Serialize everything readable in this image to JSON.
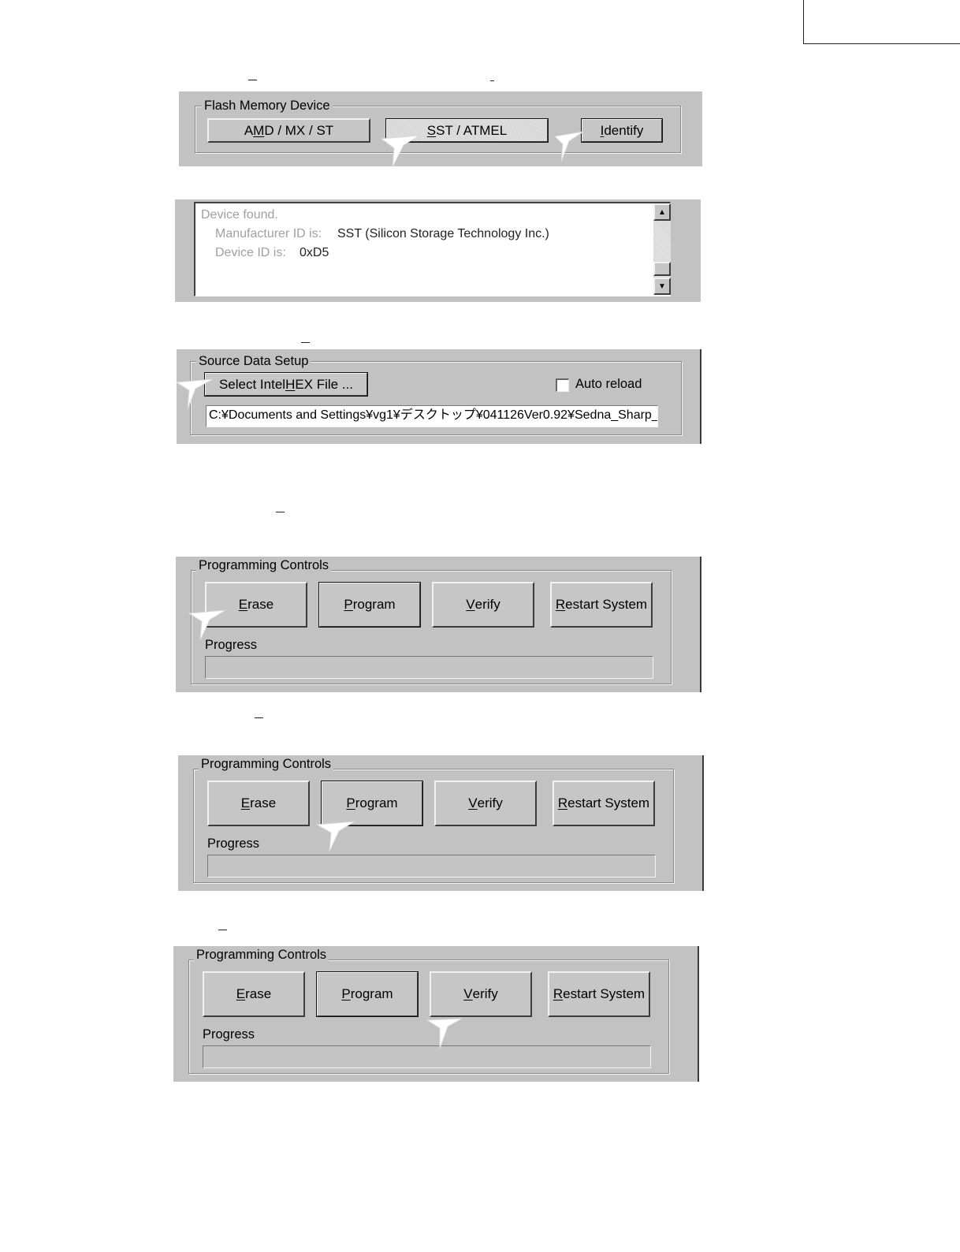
{
  "flash_memory": {
    "legend": "Flash Memory Device",
    "amd_button": {
      "pre": "A",
      "key": "M",
      "post": "D / MX / ST"
    },
    "sst_button": {
      "pre": "",
      "key": "S",
      "post": "ST / ATMEL"
    },
    "identify_button": {
      "pre": "",
      "key": "I",
      "post": "dentify"
    }
  },
  "log": {
    "line1": "Device found.",
    "manufacturer_label": "Manufacturer ID is:",
    "manufacturer_value": "SST (Silicon Storage Technology Inc.)",
    "device_label": "Device ID is:",
    "device_value": "0xD5"
  },
  "source_setup": {
    "legend": "Source Data Setup",
    "select_button": {
      "pre": "Select Intel ",
      "key": "H",
      "post": "EX File ..."
    },
    "auto_reload": {
      "key": "A",
      "post": "uto reload",
      "checked": false
    },
    "file_path": "C:¥Documents and Settings¥vg1¥デスクトップ¥041126Ver0.92¥Sedna_Sharp_"
  },
  "programming": {
    "legend": "Programming Controls",
    "erase": {
      "key": "E",
      "post": "rase"
    },
    "program": {
      "key": "P",
      "post": "rogram"
    },
    "verify": {
      "key": "V",
      "post": "erify"
    },
    "restart": {
      "key": "R",
      "post": "estart System"
    },
    "progress_label": "Progress",
    "progress_value": 0
  },
  "icons": {
    "cursor": "arrow-pointer-icon",
    "scroll_up": "scroll-up-arrow-icon",
    "scroll_down": "scroll-down-arrow-icon"
  }
}
